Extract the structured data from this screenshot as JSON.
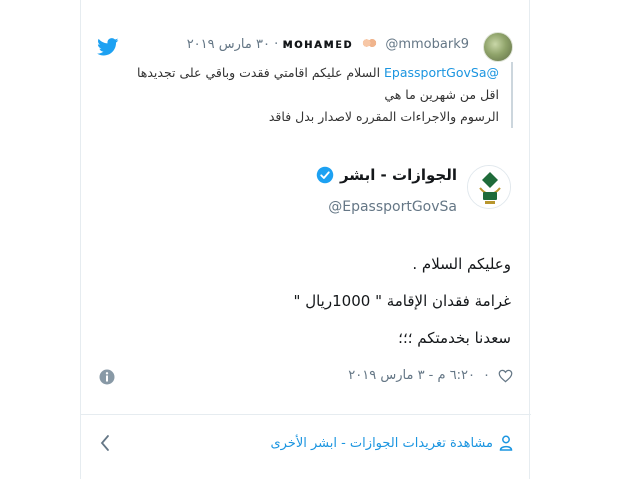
{
  "quoted": {
    "name": "ᴍᴏнᴀᴍᴇᴅ",
    "handle": "@mmobark9",
    "time": "٣٠ مارس ٢٠١٩",
    "separator": "·",
    "mention": "@EpassportGovSa",
    "text_line1": " السلام عليكم اقامتي فقدت وباقي على تجديدها اقل من شهرين ما هي",
    "text_line2": "الرسوم والاجراءات المقرره لاصدار بدل فاقد"
  },
  "tweet": {
    "name": "الجوازات - ابشر",
    "handle": "@EpassportGovSa",
    "lines": [
      "وعليكم السلام .",
      "غرامة فقدان الإقامة \" 1000ريال \"",
      "سعدنا بخدمتكم ؛؛؛"
    ],
    "like_count": "٠",
    "timestamp": "٦:٢٠ م - ٣ مارس ٢٠١٩"
  },
  "more": {
    "label": "مشاهدة تغريدات الجوازات - ابشر الأخرى"
  },
  "icons": {
    "brand": "twitter-bird-icon",
    "verified": "verified-badge-icon",
    "info": "info-icon",
    "like": "heart-icon",
    "more": "person-icon",
    "back": "chevron-left-icon"
  },
  "colors": {
    "link": "#1b95e0",
    "muted": "#657786",
    "text": "#14171a",
    "border": "#e6ecf0"
  }
}
